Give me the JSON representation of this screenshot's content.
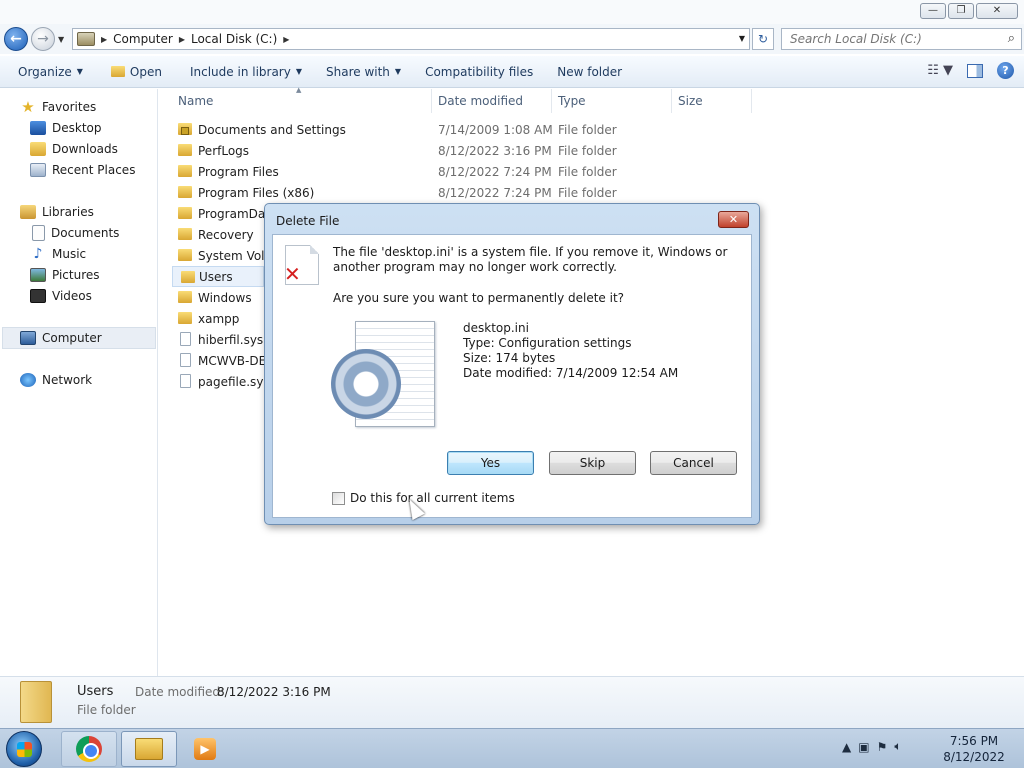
{
  "window": {
    "minimize_glyph": "—",
    "maximize_glyph": "❐",
    "close_glyph": "✕"
  },
  "address": {
    "back_glyph": "←",
    "forward_glyph": "→",
    "crumbs": [
      "Computer",
      "Local Disk (C:)"
    ],
    "search_placeholder": "Search Local Disk (C:)"
  },
  "toolbar": {
    "organize": "Organize",
    "open": "Open",
    "include": "Include in library",
    "share": "Share with",
    "compat": "Compatibility files",
    "new_folder": "New folder",
    "help_glyph": "?"
  },
  "nav": {
    "favorites": "Favorites",
    "desktop": "Desktop",
    "downloads": "Downloads",
    "recent": "Recent Places",
    "libraries": "Libraries",
    "documents": "Documents",
    "music": "Music",
    "pictures": "Pictures",
    "videos": "Videos",
    "computer": "Computer",
    "network": "Network"
  },
  "columns": {
    "name": "Name",
    "date": "Date modified",
    "type": "Type",
    "size": "Size"
  },
  "files": [
    {
      "name": "Documents and Settings",
      "date": "7/14/2009 1:08 AM",
      "type": "File folder"
    },
    {
      "name": "PerfLogs",
      "date": "8/12/2022 3:16 PM",
      "type": "File folder"
    },
    {
      "name": "Program Files",
      "date": "8/12/2022 7:24 PM",
      "type": "File folder"
    },
    {
      "name": "Program Files (x86)",
      "date": "8/12/2022 7:24 PM",
      "type": "File folder"
    },
    {
      "name": "ProgramData",
      "date": "",
      "type": ""
    },
    {
      "name": "Recovery",
      "date": "",
      "type": ""
    },
    {
      "name": "System Volu",
      "date": "",
      "type": ""
    },
    {
      "name": "Users",
      "date": "",
      "type": ""
    },
    {
      "name": "Windows",
      "date": "",
      "type": ""
    },
    {
      "name": "xampp",
      "date": "",
      "type": ""
    },
    {
      "name": "hiberfil.sys",
      "date": "",
      "type": ""
    },
    {
      "name": "MCWVB-DE",
      "date": "",
      "type": ""
    },
    {
      "name": "pagefile.sys",
      "date": "",
      "type": ""
    }
  ],
  "details": {
    "name": "Users",
    "date_label": "Date modified:",
    "date_value": "8/12/2022 3:16 PM",
    "type": "File folder"
  },
  "dialog": {
    "title": "Delete File",
    "close_glyph": "✕",
    "warn_glyph": "✕",
    "message": "The file 'desktop.ini' is a system file. If you remove it, Windows or another program may no longer work correctly.",
    "question": "Are you sure you want to permanently delete it?",
    "file_name": "desktop.ini",
    "file_type": "Type: Configuration settings",
    "file_size": "Size: 174 bytes",
    "file_date": "Date modified: 7/14/2009 12:54 AM",
    "yes": "Yes",
    "skip": "Skip",
    "cancel": "Cancel",
    "checkbox_label": "Do this for all current items"
  },
  "taskbar": {
    "time": "7:56 PM",
    "date": "8/12/2022",
    "media_glyph": "▶"
  }
}
